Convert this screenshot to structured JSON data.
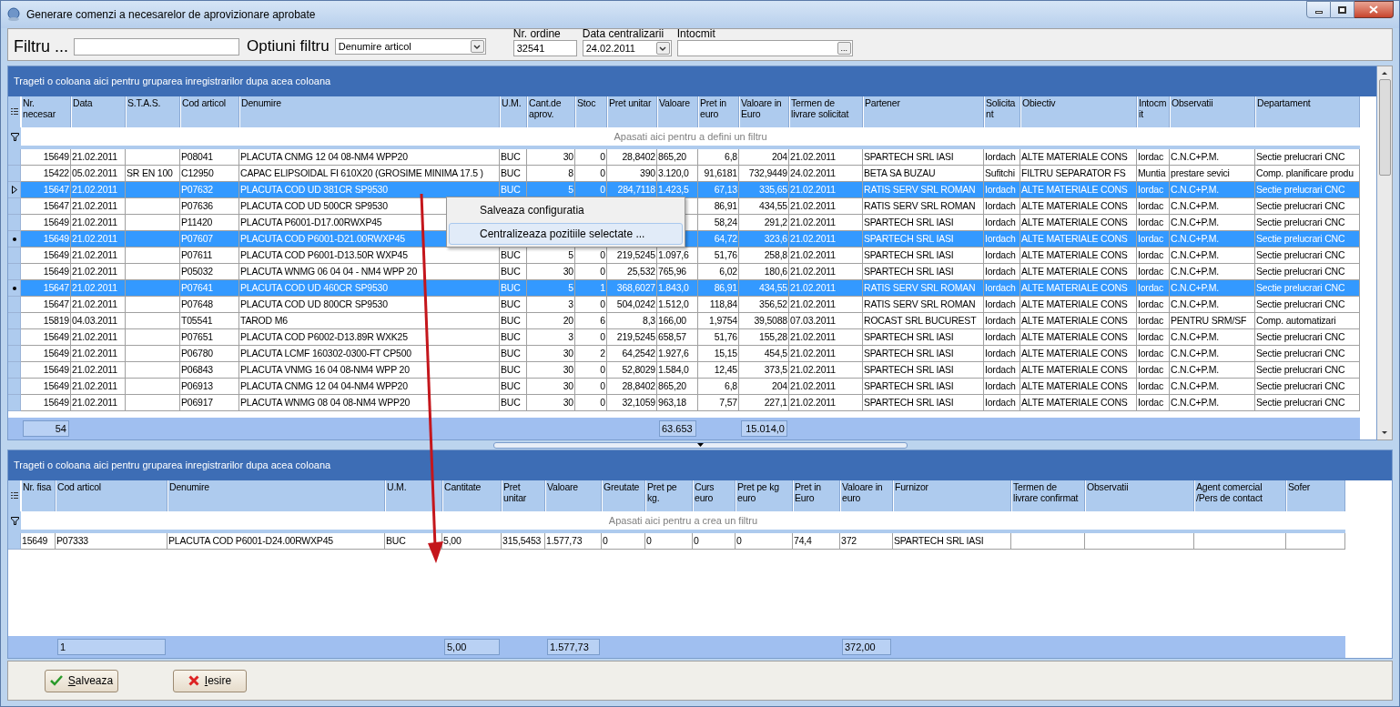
{
  "window": {
    "title": "Generare comenzi  a necesarelor de aprovizionare aprobate"
  },
  "filter_bar": {
    "filter_label": "Filtru ...",
    "options_label": "Optiuni filtru",
    "options_value": "Denumire articol",
    "order_label": "Nr. ordine",
    "order_value": "32541",
    "date_label": "Data centralizarii",
    "date_value": "24.02.2011",
    "author_label": "Intocmit",
    "browse_button": "..."
  },
  "upper_grid": {
    "group_hint": "Trageti o coloana aici pentru gruparea inregistrarilor dupa acea coloana",
    "columns": [
      "Nr. necesar",
      "Data",
      "S.T.A.S.",
      "Cod articol",
      "Denumire",
      "U.M.",
      "Cant.de aprov.",
      "Stoc",
      "Pret unitar",
      "Valoare",
      "Pret in euro",
      "Valoare in Euro",
      "Termen de livrare solicitat",
      "Partener",
      "Solicitant",
      "Obiectiv",
      "Intocmit",
      "Observatii",
      "Departament"
    ],
    "filter_hint": "Apasati aici pentru a defini un filtru",
    "rows": [
      {
        "selected": false,
        "current": false,
        "nr": "15649",
        "data": "21.02.2011",
        "cod": "P08041",
        "denumire": "PLACUTA CNMG 12 04 08-NM4 WPP20",
        "um": "BUC",
        "cant": "30",
        "stoc": "0",
        "pret_unitar": "28,8402",
        "valoare": "865,20",
        "pret_euro": "6,8",
        "valoare_euro": "204",
        "termen": "21.02.2011",
        "partener": "SPARTECH SRL IASI",
        "solicitant": "Iordach",
        "obiectiv": "ALTE MATERIALE CONS",
        "intocmit": "Iordac",
        "observatii": "C.N.C+P.M.",
        "departament": "Sectie prelucrari CNC"
      },
      {
        "selected": false,
        "current": false,
        "nr": "15422",
        "data": "05.02.2011",
        "stas": "SR EN 100",
        "cod": "C12950",
        "denumire": "CAPAC ELIPSOIDAL FI 610X20 (GROSIME MINIMA 17.5 )",
        "um": "BUC",
        "cant": "8",
        "stoc": "0",
        "pret_unitar": "390",
        "valoare": "3.120,0",
        "pret_euro": "91,6181",
        "valoare_euro": "732,9449",
        "termen": "24.02.2011",
        "partener": "BETA SA BUZAU",
        "solicitant": "Sufitchi",
        "obiectiv": "FILTRU SEPARATOR FS",
        "intocmit": "Muntia",
        "observatii": "prestare sevici",
        "departament": "Comp. planificare produ"
      },
      {
        "selected": true,
        "current": true,
        "nr": "15647",
        "data": "21.02.2011",
        "cod": "P07632",
        "denumire": "PLACUTA COD UD 381CR SP9530",
        "um": "BUC",
        "cant": "5",
        "stoc": "0",
        "pret_unitar": "284,7118",
        "valoare": "1.423,5",
        "pret_euro": "67,13",
        "valoare_euro": "335,65",
        "termen": "21.02.2011",
        "partener": "RATIS SERV SRL ROMAN",
        "solicitant": "Iordach",
        "obiectiv": "ALTE MATERIALE CONS",
        "intocmit": "Iordac",
        "observatii": "C.N.C+P.M.",
        "departament": "Sectie prelucrari CNC"
      },
      {
        "selected": false,
        "current": false,
        "nr": "15647",
        "data": "21.02.2011",
        "cod": "P07636",
        "denumire": "PLACUTA COD UD 500CR SP9530",
        "pret_euro": "86,91",
        "valoare_euro": "434,55",
        "termen": "21.02.2011",
        "partener": "RATIS SERV SRL ROMAN",
        "solicitant": "Iordach",
        "obiectiv": "ALTE MATERIALE CONS",
        "intocmit": "Iordac",
        "observatii": "C.N.C+P.M.",
        "departament": "Sectie prelucrari CNC"
      },
      {
        "selected": false,
        "current": false,
        "nr": "15649",
        "data": "21.02.2011",
        "cod": "P11420",
        "denumire": "PLACUTA P6001-D17.00RWXP45",
        "pret_euro": "58,24",
        "valoare_euro": "291,2",
        "termen": "21.02.2011",
        "partener": "SPARTECH SRL IASI",
        "solicitant": "Iordach",
        "obiectiv": "ALTE MATERIALE CONS",
        "intocmit": "Iordac",
        "observatii": "C.N.C+P.M.",
        "departament": "Sectie prelucrari CNC"
      },
      {
        "selected": true,
        "current": false,
        "nr": "15649",
        "data": "21.02.2011",
        "cod": "P07607",
        "denumire": "PLACUTA COD P6001-D21.00RWXP45",
        "pret_euro": "64,72",
        "valoare_euro": "323,6",
        "termen": "21.02.2011",
        "partener": "SPARTECH SRL IASI",
        "solicitant": "Iordach",
        "obiectiv": "ALTE MATERIALE CONS",
        "intocmit": "Iordac",
        "observatii": "C.N.C+P.M.",
        "departament": "Sectie prelucrari CNC"
      },
      {
        "selected": false,
        "current": false,
        "nr": "15649",
        "data": "21.02.2011",
        "cod": "P07611",
        "denumire": "PLACUTA COD P6001-D13.50R WXP45",
        "um": "BUC",
        "cant": "5",
        "stoc": "0",
        "pret_unitar": "219,5245",
        "valoare": "1.097,6",
        "pret_euro": "51,76",
        "valoare_euro": "258,8",
        "termen": "21.02.2011",
        "partener": "SPARTECH SRL IASI",
        "solicitant": "Iordach",
        "obiectiv": "ALTE MATERIALE CONS",
        "intocmit": "Iordac",
        "observatii": "C.N.C+P.M.",
        "departament": "Sectie prelucrari CNC"
      },
      {
        "selected": false,
        "current": false,
        "nr": "15649",
        "data": "21.02.2011",
        "cod": "P05032",
        "denumire": "PLACUTA WNMG 06 04 04 - NM4 WPP 20",
        "um": "BUC",
        "cant": "30",
        "stoc": "0",
        "pret_unitar": "25,532",
        "valoare": "765,96",
        "pret_euro": "6,02",
        "valoare_euro": "180,6",
        "termen": "21.02.2011",
        "partener": "SPARTECH SRL IASI",
        "solicitant": "Iordach",
        "obiectiv": "ALTE MATERIALE CONS",
        "intocmit": "Iordac",
        "observatii": "C.N.C+P.M.",
        "departament": "Sectie prelucrari CNC"
      },
      {
        "selected": true,
        "current": false,
        "nr": "15647",
        "data": "21.02.2011",
        "cod": "P07641",
        "denumire": "PLACUTA COD UD 460CR SP9530",
        "um": "BUC",
        "cant": "5",
        "stoc": "1",
        "pret_unitar": "368,6027",
        "valoare": "1.843,0",
        "pret_euro": "86,91",
        "valoare_euro": "434,55",
        "termen": "21.02.2011",
        "partener": "RATIS SERV SRL ROMAN",
        "solicitant": "Iordach",
        "obiectiv": "ALTE MATERIALE CONS",
        "intocmit": "Iordac",
        "observatii": "C.N.C+P.M.",
        "departament": "Sectie prelucrari CNC"
      },
      {
        "selected": false,
        "current": false,
        "nr": "15647",
        "data": "21.02.2011",
        "cod": "P07648",
        "denumire": "PLACUTA COD UD 800CR SP9530",
        "um": "BUC",
        "cant": "3",
        "stoc": "0",
        "pret_unitar": "504,0242",
        "valoare": "1.512,0",
        "pret_euro": "118,84",
        "valoare_euro": "356,52",
        "termen": "21.02.2011",
        "partener": "RATIS SERV SRL ROMAN",
        "solicitant": "Iordach",
        "obiectiv": "ALTE MATERIALE CONS",
        "intocmit": "Iordac",
        "observatii": "C.N.C+P.M.",
        "departament": "Sectie prelucrari CNC"
      },
      {
        "selected": false,
        "current": false,
        "nr": "15819",
        "data": "04.03.2011",
        "cod": "T05541",
        "denumire": "TAROD M6",
        "um": "BUC",
        "cant": "20",
        "stoc": "6",
        "pret_unitar": "8,3",
        "valoare": "166,00",
        "pret_euro": "1,9754",
        "valoare_euro": "39,5088",
        "termen": "07.03.2011",
        "partener": "ROCAST SRL BUCUREST",
        "solicitant": "Iordach",
        "obiectiv": "ALTE MATERIALE CONS",
        "intocmit": "Iordac",
        "observatii": "PENTRU SRM/SF",
        "departament": "Comp. automatizari"
      },
      {
        "selected": false,
        "current": false,
        "nr": "15649",
        "data": "21.02.2011",
        "cod": "P07651",
        "denumire": "PLACUTA COD P6002-D13.89R WXK25",
        "um": "BUC",
        "cant": "3",
        "stoc": "0",
        "pret_unitar": "219,5245",
        "valoare": "658,57",
        "pret_euro": "51,76",
        "valoare_euro": "155,28",
        "termen": "21.02.2011",
        "partener": "SPARTECH SRL IASI",
        "solicitant": "Iordach",
        "obiectiv": "ALTE MATERIALE CONS",
        "intocmit": "Iordac",
        "observatii": "C.N.C+P.M.",
        "departament": "Sectie prelucrari CNC"
      },
      {
        "selected": false,
        "current": false,
        "nr": "15649",
        "data": "21.02.2011",
        "cod": "P06780",
        "denumire": "PLACUTA LCMF 160302-0300-FT CP500",
        "um": "BUC",
        "cant": "30",
        "stoc": "2",
        "pret_unitar": "64,2542",
        "valoare": "1.927,6",
        "pret_euro": "15,15",
        "valoare_euro": "454,5",
        "termen": "21.02.2011",
        "partener": "SPARTECH SRL IASI",
        "solicitant": "Iordach",
        "obiectiv": "ALTE MATERIALE CONS",
        "intocmit": "Iordac",
        "observatii": "C.N.C+P.M.",
        "departament": "Sectie prelucrari CNC"
      },
      {
        "selected": false,
        "current": false,
        "nr": "15649",
        "data": "21.02.2011",
        "cod": "P06843",
        "denumire": "PLACUTA VNMG 16 04 08-NM4 WPP 20",
        "um": "BUC",
        "cant": "30",
        "stoc": "0",
        "pret_unitar": "52,8029",
        "valoare": "1.584,0",
        "pret_euro": "12,45",
        "valoare_euro": "373,5",
        "termen": "21.02.2011",
        "partener": "SPARTECH SRL IASI",
        "solicitant": "Iordach",
        "obiectiv": "ALTE MATERIALE CONS",
        "intocmit": "Iordac",
        "observatii": "C.N.C+P.M.",
        "departament": "Sectie prelucrari CNC"
      },
      {
        "selected": false,
        "current": false,
        "nr": "15649",
        "data": "21.02.2011",
        "cod": "P06913",
        "denumire": "PLACUTA CNMG 12 04 04-NM4 WPP20",
        "um": "BUC",
        "cant": "30",
        "stoc": "0",
        "pret_unitar": "28,8402",
        "valoare": "865,20",
        "pret_euro": "6,8",
        "valoare_euro": "204",
        "termen": "21.02.2011",
        "partener": "SPARTECH SRL IASI",
        "solicitant": "Iordach",
        "obiectiv": "ALTE MATERIALE CONS",
        "intocmit": "Iordac",
        "observatii": "C.N.C+P.M.",
        "departament": "Sectie prelucrari CNC"
      },
      {
        "selected": false,
        "current": false,
        "nr": "15649",
        "data": "21.02.2011",
        "cod": "P06917",
        "denumire": "PLACUTA WNMG 08 04 08-NM4 WPP20",
        "um": "BUC",
        "cant": "30",
        "stoc": "0",
        "pret_unitar": "32,1059",
        "valoare": "963,18",
        "pret_euro": "7,57",
        "valoare_euro": "227,1",
        "termen": "21.02.2011",
        "partener": "SPARTECH SRL IASI",
        "solicitant": "Iordach",
        "obiectiv": "ALTE MATERIALE CONS",
        "intocmit": "Iordac",
        "observatii": "C.N.C+P.M.",
        "departament": "Sectie prelucrari CNC"
      }
    ],
    "footer": {
      "nr": "54",
      "valoare": "63.653",
      "valoare_euro": "15.014,0"
    }
  },
  "context_menu": {
    "items": [
      {
        "label": "Salveaza configuratia",
        "selected": false
      },
      {
        "label": "Centralizeaza pozitiile selectate ...",
        "selected": true
      }
    ]
  },
  "lower_grid": {
    "group_hint": "Trageti o coloana aici pentru gruparea inregistrarilor dupa acea coloana",
    "columns": [
      "Nr. fisa",
      "Cod articol",
      "Denumire",
      "U.M.",
      "Cantitate",
      "Pret unitar",
      "Valoare",
      "Greutate",
      "Pret pe kg.",
      "Curs euro",
      "Pret pe kg euro",
      "Pret in Euro",
      "Valoare in euro",
      "Furnizor",
      "Termen de livrare confirmat",
      "Observatii",
      "Agent comercial /Pers de contact",
      "Sofer"
    ],
    "filter_hint": "Apasati aici pentru a crea un filtru",
    "rows": [
      {
        "selected": false,
        "current": false,
        "nr_fisa": "15649",
        "cod": "P07333",
        "denumire": "PLACUTA COD P6001-D24.00RWXP45",
        "um": "BUC",
        "cantitate": "5,00",
        "pret_unitar": "315,5453",
        "valoare": "1.577,73",
        "greutate": "0",
        "pret_kg": "0",
        "curs_euro": "0",
        "pret_kg_euro": "0",
        "pret_euro": "74,4",
        "valoare_euro": "372",
        "furnizor": "SPARTECH SRL IASI"
      }
    ],
    "footer": {
      "cod": "1",
      "cantitate": "5,00",
      "valoare": "1.577,73",
      "valoare_euro": "372,00"
    }
  },
  "buttons": [
    {
      "label": "Salveaza",
      "kind": "save"
    },
    {
      "label": "Iesire",
      "kind": "exit"
    }
  ]
}
